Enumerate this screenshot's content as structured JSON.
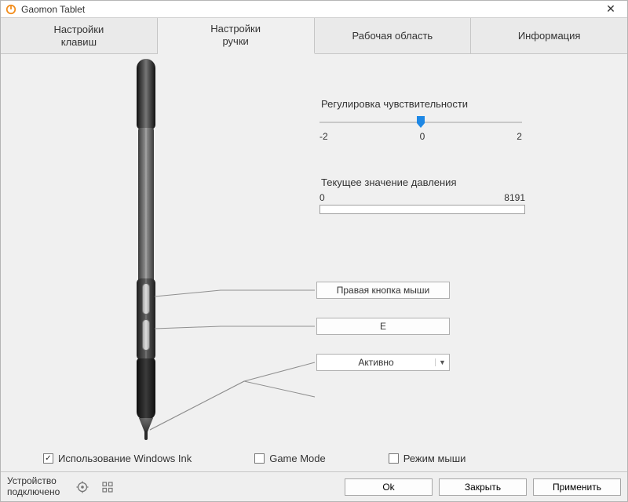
{
  "window": {
    "title": "Gaomon Tablet"
  },
  "tabs": {
    "keys": "Настройки\nклавиш",
    "pen": "Настройки\nручки",
    "area": "Рабочая область",
    "info": "Информация"
  },
  "sensitivity": {
    "label": "Регулировка чувствительности",
    "min": "-2",
    "mid": "0",
    "max": "2",
    "value": 0
  },
  "pressure": {
    "label": "Текущее значение давления",
    "min": "0",
    "max": "8191"
  },
  "pen_buttons": {
    "upper": "Правая кнопка мыши",
    "lower": "E"
  },
  "pen_mode": {
    "selected": "Активно"
  },
  "checkboxes": {
    "windows_ink": {
      "label": "Использование Windows Ink",
      "checked": true
    },
    "game_mode": {
      "label": "Game Mode",
      "checked": false
    },
    "mouse_mode": {
      "label": "Режим мыши",
      "checked": false
    }
  },
  "footer": {
    "status": "Устройство\nподключено",
    "ok": "Ok",
    "close": "Закрыть",
    "apply": "Применить"
  }
}
